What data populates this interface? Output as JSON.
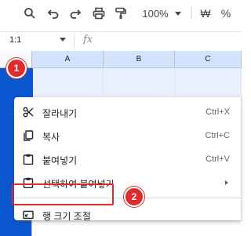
{
  "toolbar": {
    "zoom": "100%",
    "currency": "₩",
    "percent": "%",
    "icons": [
      "search-icon",
      "undo-icon",
      "redo-icon",
      "print-icon",
      "paint-format-icon"
    ]
  },
  "formula_bar": {
    "name_box": "1:1",
    "fx": "fx"
  },
  "grid": {
    "columns": [
      "A",
      "B",
      "C"
    ],
    "row_number": "1"
  },
  "context_menu": {
    "items": [
      {
        "label": "잘라내기",
        "shortcut": "Ctrl+X",
        "icon": "scissors-icon"
      },
      {
        "label": "복사",
        "shortcut": "Ctrl+C",
        "icon": "copy-icon"
      },
      {
        "label": "붙여넣기",
        "shortcut": "Ctrl+V",
        "icon": "clipboard-icon"
      },
      {
        "label": "선택하여 붙여넣기",
        "shortcut": "",
        "icon": "clipboard-icon"
      },
      {
        "label": "행 크기 조절",
        "shortcut": "",
        "icon": "resize-icon"
      }
    ]
  },
  "annotations": {
    "badge_1": "1",
    "badge_2": "2",
    "color": "#e02b2b"
  }
}
